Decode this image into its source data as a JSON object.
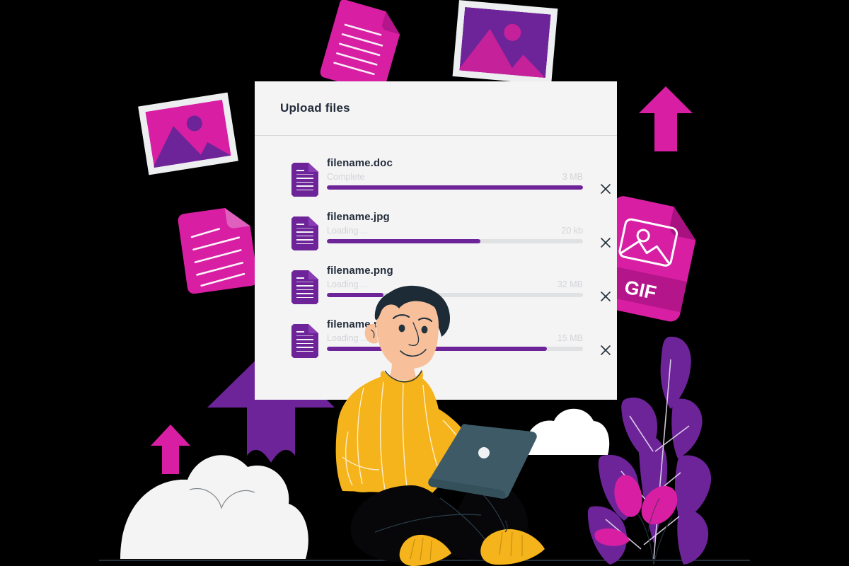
{
  "panel": {
    "title": "Upload files",
    "remove_icon": "close-icon",
    "file_icon": "document-icon",
    "files": [
      {
        "name": "filename.doc",
        "status": "Complete",
        "size": "3 MB",
        "progress": 100
      },
      {
        "name": "filename.jpg",
        "status": "Loading ...",
        "size": "20 kb",
        "progress": 60
      },
      {
        "name": "filename.png",
        "status": "Loading ...",
        "size": "32 MB",
        "progress": 22
      },
      {
        "name": "filename.pdf",
        "status": "Loading ...",
        "size": "15 MB",
        "progress": 86
      }
    ]
  },
  "decorations": {
    "gif_card_label": "GIF",
    "photo_top_left": "image-file-icon",
    "photo_top_right": "image-file-icon",
    "doc_top": "document-icon",
    "doc_left": "document-icon",
    "arrow_right": "up-arrow-icon",
    "arrow_large": "up-arrow-icon",
    "arrow_small": "up-arrow-icon",
    "plant": "plant-icon",
    "cloud": "cloud-icon",
    "character": "person-with-laptop-illustration"
  },
  "colors": {
    "purple": "#6e2499",
    "purple_dark": "#5d1f80",
    "magenta": "#d81fa4",
    "magenta_deep": "#b5158a",
    "panel_bg": "#f4f4f5",
    "track": "#e0e1e3",
    "text_dark": "#232d3b",
    "text_muted": "#d2d4d7",
    "yellow": "#f5b31c",
    "skin": "#f7bf9a",
    "hair": "#1d2b36",
    "laptop": "#3d5a66",
    "background": "#000000"
  }
}
